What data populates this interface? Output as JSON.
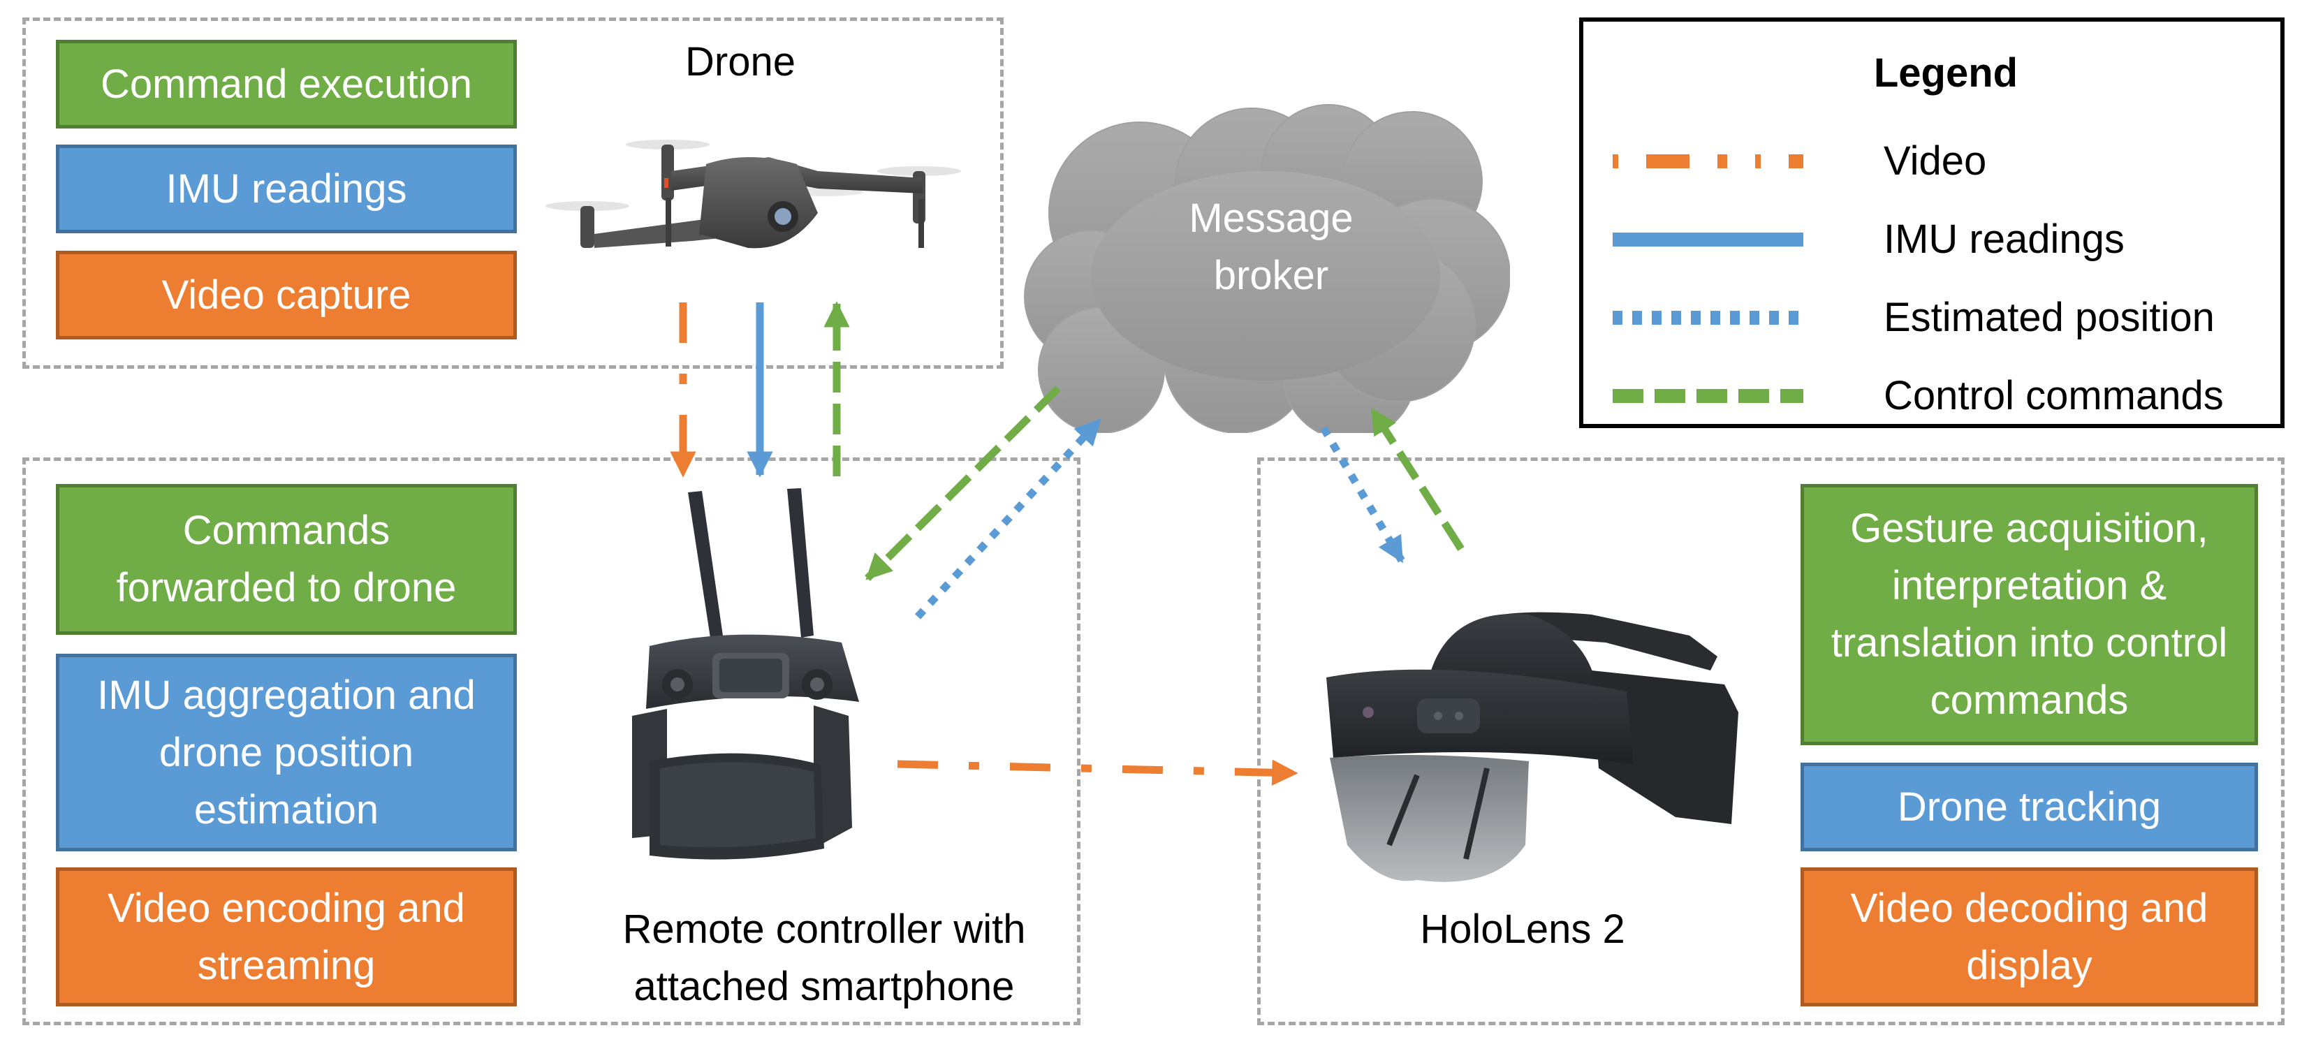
{
  "colors": {
    "green": "#70ad47",
    "blue": "#5b9bd5",
    "orange": "#ed7d31",
    "cloud_top": "#ababab",
    "cloud_bottom": "#959595",
    "group_border": "#a6a6a6"
  },
  "drone": {
    "title": "Drone",
    "image_label": "drone-photo",
    "boxes": [
      {
        "label": "Command execution",
        "color": "green"
      },
      {
        "label": "IMU readings",
        "color": "blue"
      },
      {
        "label": "Video capture",
        "color": "orange"
      }
    ]
  },
  "controller": {
    "caption_line1": "Remote controller with",
    "caption_line2": "attached smartphone",
    "image_label": "remote-controller-photo",
    "boxes": [
      {
        "label": "Commands forwarded to drone",
        "color": "green"
      },
      {
        "label": "IMU aggregation and drone position estimation",
        "color": "blue"
      },
      {
        "label": "Video encoding and streaming",
        "color": "orange"
      }
    ]
  },
  "hololens": {
    "caption": "HoloLens 2",
    "image_label": "hololens-photo",
    "boxes": [
      {
        "label": "Gesture acquisition, interpretation & translation into control commands",
        "color": "green"
      },
      {
        "label": "Drone tracking",
        "color": "blue"
      },
      {
        "label": "Video decoding and display",
        "color": "orange"
      }
    ]
  },
  "broker": {
    "line1": "Message",
    "line2": "broker"
  },
  "legend": {
    "title": "Legend",
    "items": [
      {
        "label": "Video",
        "style": "dash-dot",
        "color": "orange"
      },
      {
        "label": "IMU readings",
        "style": "solid",
        "color": "blue"
      },
      {
        "label": "Estimated position",
        "style": "dotted",
        "color": "blue"
      },
      {
        "label": "Control commands",
        "style": "dashed",
        "color": "green"
      }
    ]
  },
  "connections": [
    {
      "from": "drone",
      "to": "controller",
      "type": "Video"
    },
    {
      "from": "drone",
      "to": "controller",
      "type": "IMU readings"
    },
    {
      "from": "controller",
      "to": "drone",
      "type": "Control commands"
    },
    {
      "from": "broker",
      "to": "controller",
      "type": "Control commands"
    },
    {
      "from": "controller",
      "to": "broker",
      "type": "Estimated position"
    },
    {
      "from": "broker",
      "to": "hololens",
      "type": "Estimated position"
    },
    {
      "from": "hololens",
      "to": "broker",
      "type": "Control commands"
    },
    {
      "from": "controller",
      "to": "hololens",
      "type": "Video"
    }
  ]
}
